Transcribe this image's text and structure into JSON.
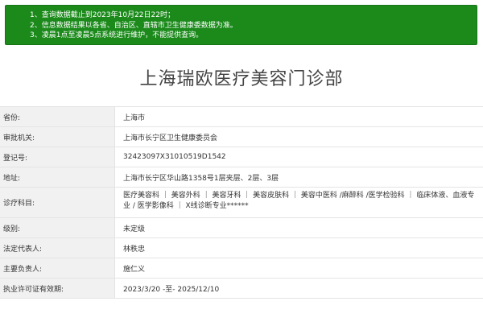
{
  "notice": {
    "lines": [
      "1、查询数据截止到2023年10月22日22时；",
      "2、信息数据结果以各省、自治区、直辖市卫生健康委数据为准。",
      "3、凌晨1点至凌晨5点系统进行维护，不能提供查询。"
    ]
  },
  "title": "上海瑞欧医疗美容门诊部",
  "rows": [
    {
      "label": "省份:",
      "value": "上海市"
    },
    {
      "label": "审批机关:",
      "value": "上海市长宁区卫生健康委员会"
    },
    {
      "label": "登记号:",
      "value": "32423097X31010519D1542"
    },
    {
      "label": "地址:",
      "value": "上海市长宁区华山路1358号1层夹层、2层、3层"
    },
    {
      "label": "诊疗科目:",
      "value": "医疗美容科 ｜ 美容外科 ｜ 美容牙科 ｜ 美容皮肤科 ｜ 美容中医科 /麻醉科 /医学检验科 ｜ 临床体液、血液专业 / 医学影像科 ｜ X线诊断专业******"
    },
    {
      "label": "级别:",
      "value": "未定级"
    },
    {
      "label": "法定代表人:",
      "value": "林秩忠"
    },
    {
      "label": "主要负责人:",
      "value": "施仁义"
    },
    {
      "label": "执业许可证有效期:",
      "value": "2023/3/20 -至- 2025/12/10"
    }
  ]
}
